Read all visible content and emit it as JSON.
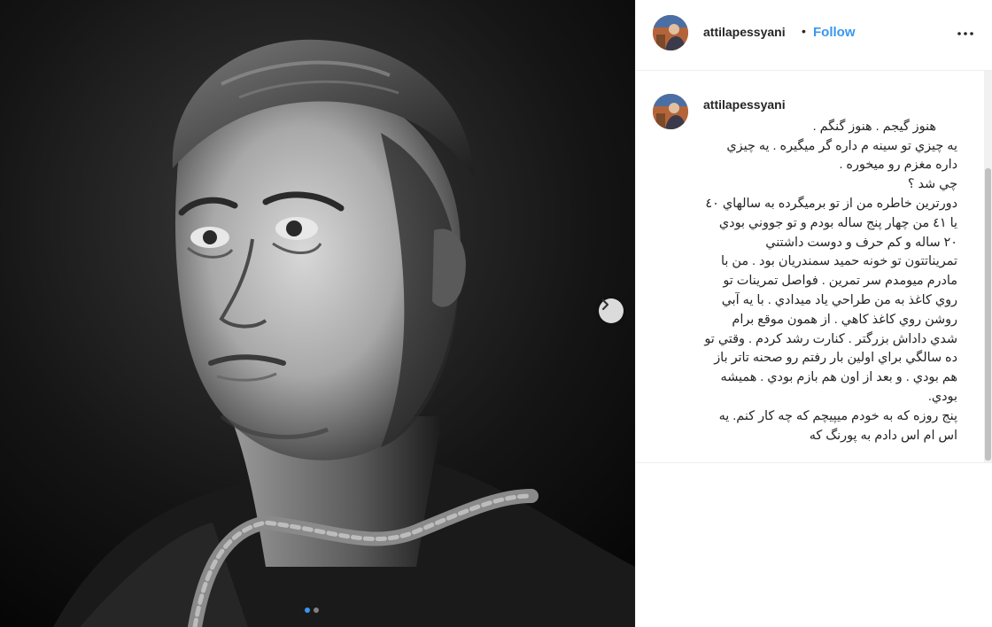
{
  "post": {
    "username": "attilapessyani",
    "separator": "•",
    "follow_label": "Follow",
    "more_icon": "more-horizontal-icon",
    "carousel": {
      "total_slides": 2,
      "active_slide": 1
    },
    "caption": "هنوز گيجم . هنوز گنگم .\nيه چيزي تو سينه م داره گر ميگيره . يه چيزي داره مغزم رو ميخوره .\nچي شد ؟\nدورترين خاطره من از تو برميگرده به سالهاي ٤٠ يا ٤١ من چهار پنج ساله بودم و تو جووني بودي ٢٠ ساله و كم حرف و دوست داشتني\nتمريناتتون تو خونه حميد سمندريان بود . من با مادرم ميومدم سر تمرين . فواصل تمرينات تو روي كاغذ به من طراحي ياد ميدادي . با يه آبي روشن روي كاغذ كاهي . از همون موقع برام شدي داداش بزرگتر . كنارت رشد كردم . وقتي تو ده سالگي براي اولين بار رفتم رو صحنه تاتر باز هم بودي . و بعد از اون هم بازم بودي . هميشه بودي.\nپنج روزه كه به خودم ميپيچم كه چه كار كنم. يه اس ام اس دادم به پورنگ كه"
  },
  "colors": {
    "accent": "#3897f0",
    "text": "#262626",
    "divider": "#efefef"
  }
}
